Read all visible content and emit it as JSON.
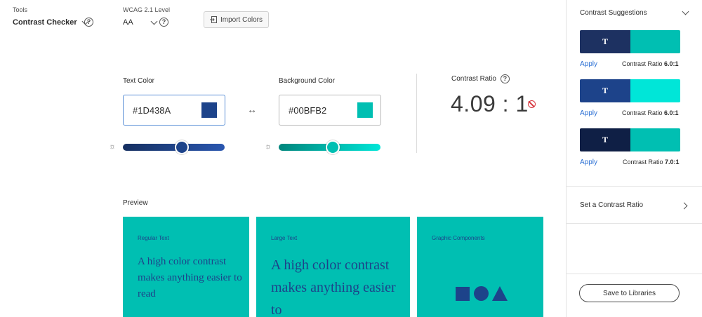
{
  "toolbar": {
    "tools_label": "Tools",
    "tools_value": "Contrast Checker",
    "wcag_label": "WCAG 2.1 Level",
    "wcag_value": "AA",
    "import_label": "Import Colors"
  },
  "text_color": {
    "label": "Text Color",
    "value": "#1D438A",
    "swatch": "#1D438A",
    "slider_level": 0.58
  },
  "background_color": {
    "label": "Background Color",
    "value": "#00BFB2",
    "swatch": "#00BFB2",
    "slider_level": 0.53
  },
  "contrast": {
    "label": "Contrast Ratio",
    "value": "4.09 : 1",
    "status": "fail"
  },
  "preview": {
    "label": "Preview",
    "cards": [
      {
        "title": "Regular Text",
        "text": "A high color contrast makes anything easier to read"
      },
      {
        "title": "Large Text",
        "text": "A high color contrast makes anything easier to"
      },
      {
        "title": "Graphic Components"
      }
    ]
  },
  "panel": {
    "suggestions_title": "Contrast Suggestions",
    "suggestions": [
      {
        "letter": "T",
        "fg": "#1D3161",
        "bg": "#00BFB2",
        "apply": "Apply",
        "note_prefix": "Contrast Ratio ",
        "ratio": "6.0:1"
      },
      {
        "letter": "T",
        "fg": "#1D438A",
        "bg": "#00E6D8",
        "apply": "Apply",
        "note_prefix": "Contrast Ratio ",
        "ratio": "6.0:1"
      },
      {
        "letter": "T",
        "fg": "#0F1F45",
        "bg": "#00BFB2",
        "apply": "Apply",
        "note_prefix": "Contrast Ratio ",
        "ratio": "7.0:1"
      }
    ],
    "set_ratio_label": "Set a Contrast Ratio",
    "save_label": "Save to Libraries"
  },
  "colors": {
    "accent_link": "#2a6fd4",
    "fail": "#d7373f",
    "text_slider_dark": "#152f60",
    "text_slider_light": "#2a57b0",
    "bg_slider_dark": "#00857c",
    "bg_slider_light": "#00e6d8"
  }
}
